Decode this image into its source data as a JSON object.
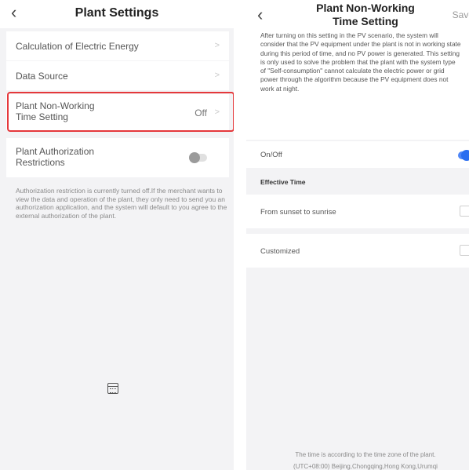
{
  "left": {
    "header": {
      "back_icon": "‹",
      "title": "Plant Settings"
    },
    "rows": [
      {
        "label": "Calculation of Electric Energy"
      },
      {
        "label": "Data Source"
      },
      {
        "label_line1": "Plant Non-Working",
        "label_line2": "Time Setting",
        "value": "Off"
      },
      {
        "label_line1": "Plant Authorization",
        "label_line2": "Restrictions",
        "toggle": "off"
      }
    ],
    "note": "Authorization restriction is currently turned off.If the merchant wants to view the data and operation of the plant, they only need to send you an authorization application, and the system will default to you agree to the external authorization of the plant.",
    "highlight_color": "#e5383b",
    "bottom_icon": "calendar-icon"
  },
  "right": {
    "header": {
      "back_icon": "‹",
      "title_line1": "Plant Non-Working",
      "title_line2": "Time Setting",
      "save": "Save"
    },
    "description": "After turning on this setting in the PV scenario, the system will consider that the PV equipment under the plant is not in working state during this period of time, and no PV power is generated. This setting is only used to solve the problem that the plant with the system type of \"Self-consumption\" cannot calculate the electric power or grid power through the algorithm because the PV equipment does not work at night.",
    "onoff_label": "On/Off",
    "onoff_state": "on",
    "section_title": "Effective Time",
    "options": [
      {
        "label": "From sunset to sunrise",
        "checked": false
      },
      {
        "label": "Customized",
        "checked": false
      }
    ],
    "tz_line1": "The time is according to the time zone of the plant.",
    "tz_line2": "(UTC+08:00) Beijing,Chongqing,Hong Kong,Urumqi",
    "accent_color": "#2a6ef0"
  }
}
